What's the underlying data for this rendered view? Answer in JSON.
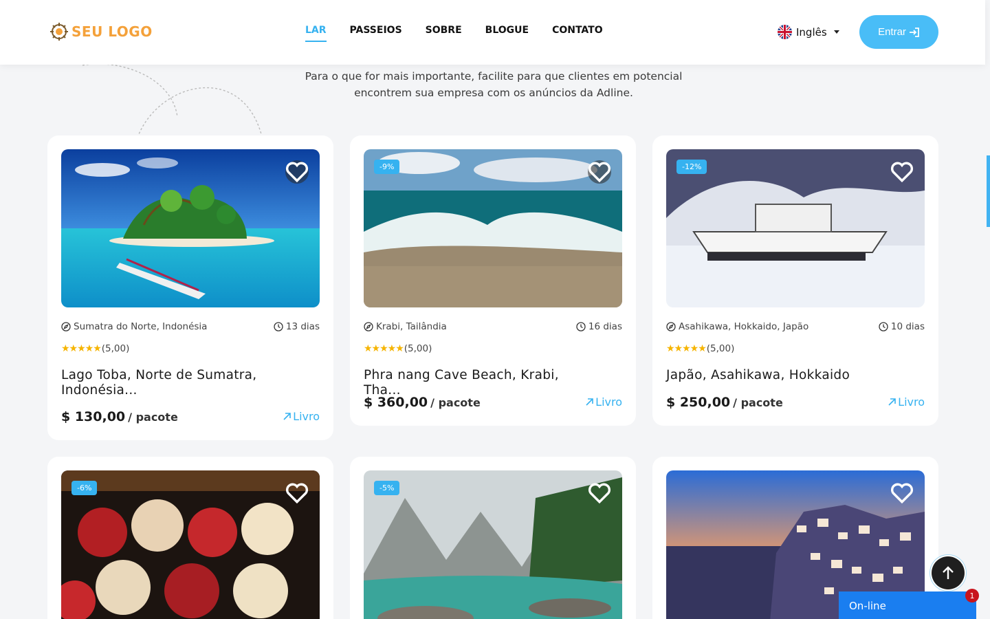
{
  "header": {
    "logo_text": "SEU LOGO",
    "nav": [
      "LAR",
      "PASSEIOS",
      "SOBRE",
      "BLOGUE",
      "CONTATO"
    ],
    "active_nav": "LAR",
    "language": "Inglês",
    "login_label": "Entrar"
  },
  "intro_text": "Para o que for mais importante, facilite para que clientes em potencial encontrem sua empresa com os anúncios da Adline.",
  "tours": [
    {
      "location": "Sumatra do Norte, Indonésia",
      "duration": "13 dias",
      "rating": "(5,00)",
      "stars": 5,
      "title": "Lago Toba, Norte de Sumatra, Indonésia...",
      "price": "$ 130,00",
      "per": "/ pacote",
      "book": "Livro",
      "discount": "",
      "image": "tropical-island"
    },
    {
      "location": "Krabi, Tailândia",
      "duration": "16 dias",
      "rating": "(5,00)",
      "stars": 5,
      "title": "Phra nang Cave Beach, Krabi, Tha...",
      "price": "$ 360,00",
      "per": "/ pacote",
      "book": "Livro",
      "discount": "-9%",
      "image": "ocean-wave"
    },
    {
      "location": "Asahikawa, Hokkaido, Japão",
      "duration": "10 dias",
      "rating": "(5,00)",
      "stars": 5,
      "title": "Japão, Asahikawa, Hokkaido",
      "price": "$ 250,00",
      "per": "/ pacote",
      "book": "Livro",
      "discount": "-12%",
      "image": "snow-boats"
    },
    {
      "location": "",
      "duration": "",
      "rating": "",
      "stars": 0,
      "title": "",
      "price": "",
      "per": "",
      "book": "",
      "discount": "-6%",
      "image": "umbrellas"
    },
    {
      "location": "",
      "duration": "",
      "rating": "",
      "stars": 0,
      "title": "",
      "price": "",
      "per": "",
      "book": "",
      "discount": "-5%",
      "image": "mountain-lake"
    },
    {
      "location": "",
      "duration": "",
      "rating": "",
      "stars": 0,
      "title": "",
      "price": "",
      "per": "",
      "book": "",
      "discount": "",
      "image": "santorini-night"
    }
  ],
  "chat": {
    "label": "On-line",
    "count": "1"
  },
  "colors": {
    "accent": "#36b2f0",
    "logo": "#f4a13a",
    "chat": "#1a7ef0",
    "star": "#f6b400"
  }
}
